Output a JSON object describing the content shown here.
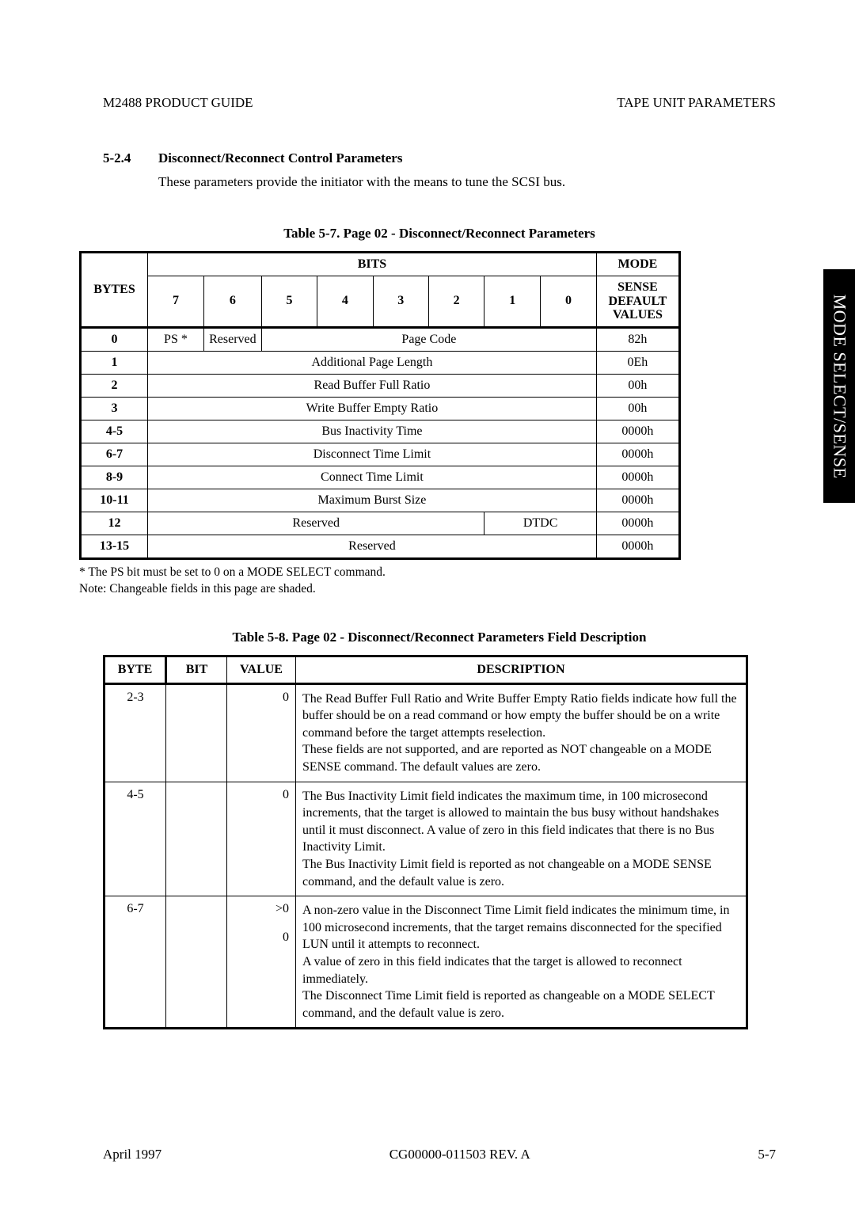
{
  "header": {
    "left": "M2488 PRODUCT GUIDE",
    "right": "TAPE UNIT PARAMETERS"
  },
  "section": {
    "number": "5-2.4",
    "title": "Disconnect/Reconnect Control Parameters",
    "body": "These parameters provide the initiator with the means to tune the SCSI bus."
  },
  "sidebar": "MODE SELECT/SENSE",
  "table1": {
    "caption": "Table 5-7.   Page 02 - Disconnect/Reconnect Parameters",
    "bits_header": "BITS",
    "bytes_header": "BYTES",
    "mode_header_l1": "MODE",
    "mode_header_l2": "SENSE",
    "mode_header_l3": "DEFAULT",
    "mode_header_l4": "VALUES",
    "bit_labels": [
      "7",
      "6",
      "5",
      "4",
      "3",
      "2",
      "1",
      "0"
    ],
    "rows": [
      {
        "byte": "0",
        "cells": [
          "PS *",
          "Reserved",
          "Page Code"
        ],
        "value": "82h",
        "spans": [
          1,
          1,
          6
        ]
      },
      {
        "byte": "1",
        "cells": [
          "Additional Page Length"
        ],
        "value": "0Eh",
        "spans": [
          8
        ]
      },
      {
        "byte": "2",
        "cells": [
          "Read Buffer Full Ratio"
        ],
        "value": "00h",
        "spans": [
          8
        ]
      },
      {
        "byte": "3",
        "cells": [
          "Write Buffer Empty Ratio"
        ],
        "value": "00h",
        "spans": [
          8
        ]
      },
      {
        "byte": "4-5",
        "cells": [
          "Bus Inactivity Time"
        ],
        "value": "0000h",
        "spans": [
          8
        ]
      },
      {
        "byte": "6-7",
        "cells": [
          "Disconnect Time Limit"
        ],
        "value": "0000h",
        "spans": [
          8
        ]
      },
      {
        "byte": "8-9",
        "cells": [
          "Connect Time Limit"
        ],
        "value": "0000h",
        "spans": [
          8
        ]
      },
      {
        "byte": "10-11",
        "cells": [
          "Maximum Burst Size"
        ],
        "value": "0000h",
        "spans": [
          8
        ]
      },
      {
        "byte": "12",
        "cells": [
          "Reserved",
          "DTDC"
        ],
        "value": "0000h",
        "spans": [
          6,
          2
        ]
      },
      {
        "byte": "13-15",
        "cells": [
          "Reserved"
        ],
        "value": "0000h",
        "spans": [
          8
        ]
      }
    ]
  },
  "notes": {
    "line1": "* The PS bit must be set to 0 on a MODE SELECT command.",
    "line2": "Note: Changeable fields in this page are shaded."
  },
  "table2": {
    "caption": "Table 5-8.   Page 02 - Disconnect/Reconnect Parameters Field Description",
    "headers": {
      "byte": "BYTE",
      "bit": "BIT",
      "value": "VALUE",
      "desc": "DESCRIPTION"
    },
    "rows": [
      {
        "byte": "2-3",
        "bit": "",
        "value": "0",
        "desc": "The Read Buffer Full Ratio and Write Buffer Empty Ratio fields indicate how full the buffer should be on a read command or how empty the buffer should be on a write command before the target attempts reselection.\nThese fields are not supported, and are reported as NOT changeable on a MODE SENSE command. The default values are zero."
      },
      {
        "byte": "4-5",
        "bit": "",
        "value": "0",
        "desc": "The Bus Inactivity Limit field indicates the maximum time, in 100 microsecond increments, that the target is allowed to maintain the bus busy without handshakes until it must disconnect. A value of zero in this field indicates that there is no Bus Inactivity Limit.\nThe Bus Inactivity Limit field is reported as not changeable on a MODE SENSE command, and the default value is zero."
      },
      {
        "byte": "6-7",
        "bit": "",
        "value": ">0\n\n0",
        "desc": "A non-zero value in the Disconnect Time Limit field indicates the minimum time, in 100 microsecond increments, that the target remains disconnected for the specified LUN until it attempts to reconnect.\nA value of zero in this field indicates that the target is allowed to reconnect immediately.\nThe Disconnect Time Limit field is reported as changeable on a MODE SELECT command, and the default value is zero."
      }
    ]
  },
  "footer": {
    "left": "April 1997",
    "center": "CG00000-011503 REV. A",
    "right": "5-7"
  }
}
